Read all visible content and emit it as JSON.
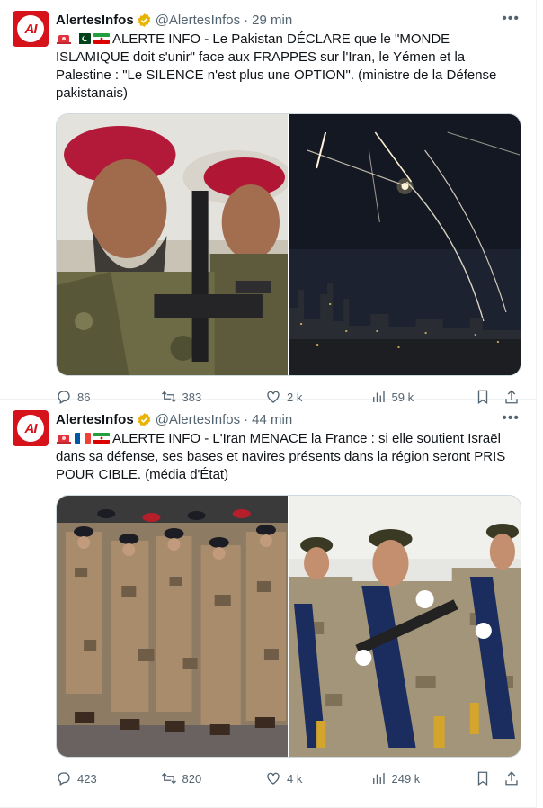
{
  "tweets": [
    {
      "author": "AlertesInfos",
      "handle": "@AlertesInfos",
      "separator": "·",
      "time": "29 min",
      "text": "ALERTE INFO - Le Pakistan DÉCLARE que le \"MONDE ISLAMIQUE doit s'unir\" face aux FRAPPES sur l'Iran, le Yémen et la Palestine : \"Le SILENCE n'est plus une OPTION\". (ministre de la Défense pakistanais)",
      "replies": "86",
      "reposts": "383",
      "likes": "2 k",
      "views": "59 k",
      "media": [
        "soldiers-red-berets-photo",
        "missile-interceptions-night-sky-photo"
      ]
    },
    {
      "author": "AlertesInfos",
      "handle": "@AlertesInfos",
      "separator": "·",
      "time": "44 min",
      "text": "ALERTE INFO - L'Iran MENACE la France : si elle soutient Israël dans sa défense, ses bases et navires présents dans la région seront PRIS POUR CIBLE. (média d'État)",
      "replies": "423",
      "reposts": "820",
      "likes": "4 k",
      "views": "249 k",
      "media": [
        "french-soldiers-parade-photo",
        "iranian-soldiers-parade-photo"
      ]
    }
  ],
  "colors": {
    "brand": "#d6121b",
    "verified": "#e8b400",
    "muted": "#536471",
    "border": "#cfd9de"
  },
  "icons": [
    "more-icon",
    "verified-badge-icon",
    "reply-icon",
    "repost-icon",
    "like-icon",
    "views-icon",
    "bookmark-icon",
    "share-icon"
  ]
}
